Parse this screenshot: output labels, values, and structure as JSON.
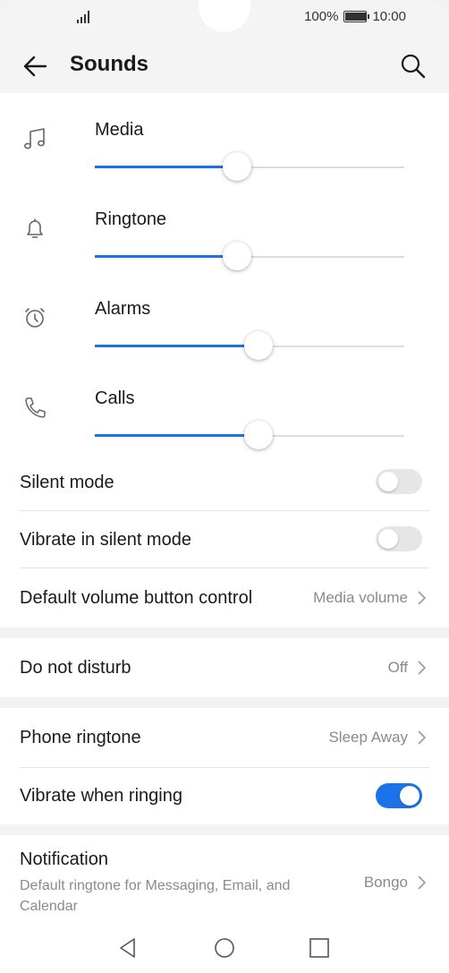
{
  "status_bar": {
    "battery": "100%",
    "battery_level": 1.0,
    "time": "10:00"
  },
  "header": {
    "title": "Sounds"
  },
  "volumes": [
    {
      "label": "Media",
      "icon": "music-note-icon",
      "level": 0.46
    },
    {
      "label": "Ringtone",
      "icon": "bell-icon",
      "level": 0.46
    },
    {
      "label": "Alarms",
      "icon": "alarm-clock-icon",
      "level": 0.53
    },
    {
      "label": "Calls",
      "icon": "phone-icon",
      "level": 0.53
    }
  ],
  "settings": {
    "silent_mode": {
      "label": "Silent mode",
      "enabled": false
    },
    "vibrate_silent": {
      "label": "Vibrate in silent mode",
      "enabled": false
    },
    "volume_button": {
      "label": "Default volume button control",
      "value": "Media volume"
    },
    "dnd": {
      "label": "Do not disturb",
      "value": "Off"
    },
    "phone_ringtone": {
      "label": "Phone ringtone",
      "value": "Sleep Away"
    },
    "vibrate_ringing": {
      "label": "Vibrate when ringing",
      "enabled": true
    },
    "notification": {
      "label": "Notification",
      "sublabel": "Default ringtone for Messaging, Email, and Calendar",
      "value": "Bongo"
    }
  },
  "colors": {
    "accent": "#1a73e8",
    "toggle_off": "#e6e6e6",
    "secondary_text": "#8a8a8a",
    "section_background": "#f2f2f2"
  }
}
